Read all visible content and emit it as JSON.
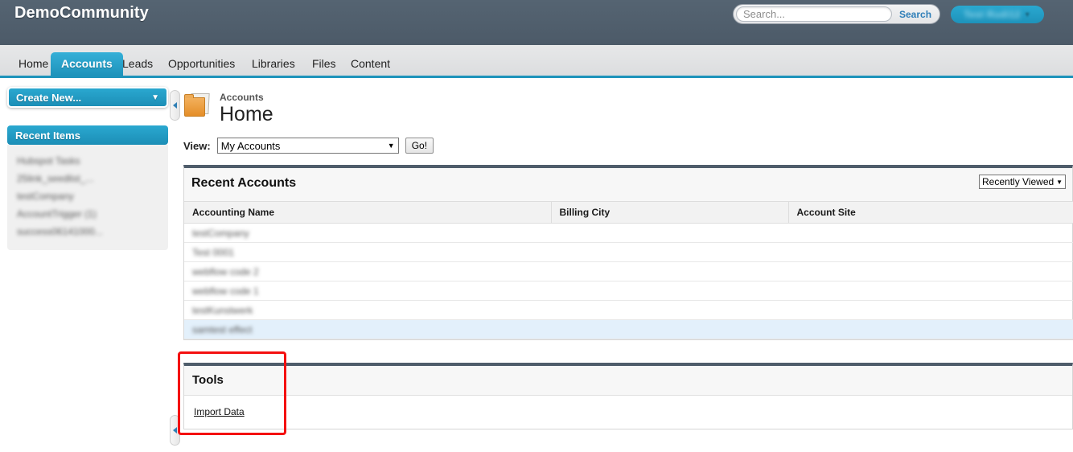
{
  "header": {
    "brand": "DemoCommunity",
    "search": {
      "placeholder": "Search...",
      "value": "",
      "button_label": "Search"
    },
    "user_menu": {
      "label": "Test Rudi12",
      "caret": "▼",
      "redacted": true
    }
  },
  "tabs": [
    {
      "label": "Home",
      "active": false
    },
    {
      "label": "Accounts",
      "active": true
    },
    {
      "label": "Leads",
      "active": false
    },
    {
      "label": "Opportunities",
      "active": false
    },
    {
      "label": "Libraries",
      "active": false
    },
    {
      "label": "Files",
      "active": false
    },
    {
      "label": "Content",
      "active": false
    }
  ],
  "sidebar": {
    "create_new": {
      "label": "Create New...",
      "caret": "▼"
    },
    "recent_items": {
      "title": "Recent Items",
      "items": [
        {
          "label": "Hubspot Tasks",
          "redacted": true
        },
        {
          "label": "25link_seedlist_...",
          "redacted": true
        },
        {
          "label": "testCompany",
          "redacted": true
        },
        {
          "label": "AccountTrigger (1)",
          "redacted": true
        },
        {
          "label": "success06141000...",
          "redacted": true
        }
      ]
    },
    "collapse_handle_icon": "◀"
  },
  "main": {
    "page_kicker": "Accounts",
    "page_title": "Home",
    "folder_icon": "folder-icon",
    "view": {
      "label": "View:",
      "selected": "My Accounts",
      "caret": "▼",
      "go_label": "Go!"
    },
    "recent_accounts": {
      "title": "Recent Accounts",
      "scope": {
        "selected": "Recently Viewed",
        "caret": "▼"
      },
      "columns": [
        "Accounting Name",
        "Billing City",
        "Account Site"
      ],
      "rows": [
        {
          "name": "testCompany",
          "billing_city": "",
          "account_site": "",
          "redacted": true,
          "highlighted": false
        },
        {
          "name": "Test 0001",
          "billing_city": "",
          "account_site": "",
          "redacted": true,
          "highlighted": false
        },
        {
          "name": "webflow code 2",
          "billing_city": "",
          "account_site": "",
          "redacted": true,
          "highlighted": false
        },
        {
          "name": "webflow code 1",
          "billing_city": "",
          "account_site": "",
          "redacted": true,
          "highlighted": false
        },
        {
          "name": "testKunstwerk",
          "billing_city": "",
          "account_site": "",
          "redacted": true,
          "highlighted": false
        },
        {
          "name": "samtest effect",
          "billing_city": "",
          "account_site": "",
          "redacted": true,
          "highlighted": true
        }
      ]
    },
    "tools": {
      "title": "Tools",
      "links": [
        {
          "label": "Import Data"
        }
      ]
    }
  },
  "annotation": {
    "shape": "rectangle",
    "color": "#f41010",
    "target": "tools-panel"
  },
  "colors": {
    "topbar": "#4f5d6b",
    "accent_teal": "#1e93bb",
    "panel_top_border": "#4f5d6b",
    "row_highlight": "#e3f0fb",
    "annotation_red": "#f41010",
    "link_blue": "#2e7eb8"
  }
}
